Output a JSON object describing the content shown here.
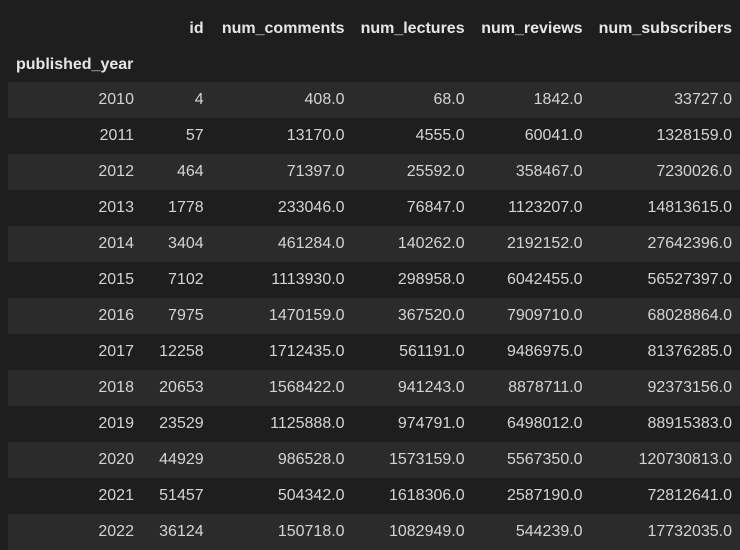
{
  "table": {
    "index_name": "published_year",
    "columns": [
      "id",
      "num_comments",
      "num_lectures",
      "num_reviews",
      "num_subscribers"
    ],
    "rows": [
      {
        "year": "2010",
        "cells": [
          "4",
          "408.0",
          "68.0",
          "1842.0",
          "33727.0"
        ]
      },
      {
        "year": "2011",
        "cells": [
          "57",
          "13170.0",
          "4555.0",
          "60041.0",
          "1328159.0"
        ]
      },
      {
        "year": "2012",
        "cells": [
          "464",
          "71397.0",
          "25592.0",
          "358467.0",
          "7230026.0"
        ]
      },
      {
        "year": "2013",
        "cells": [
          "1778",
          "233046.0",
          "76847.0",
          "1123207.0",
          "14813615.0"
        ]
      },
      {
        "year": "2014",
        "cells": [
          "3404",
          "461284.0",
          "140262.0",
          "2192152.0",
          "27642396.0"
        ]
      },
      {
        "year": "2015",
        "cells": [
          "7102",
          "1113930.0",
          "298958.0",
          "6042455.0",
          "56527397.0"
        ]
      },
      {
        "year": "2016",
        "cells": [
          "7975",
          "1470159.0",
          "367520.0",
          "7909710.0",
          "68028864.0"
        ]
      },
      {
        "year": "2017",
        "cells": [
          "12258",
          "1712435.0",
          "561191.0",
          "9486975.0",
          "81376285.0"
        ]
      },
      {
        "year": "2018",
        "cells": [
          "20653",
          "1568422.0",
          "941243.0",
          "8878711.0",
          "92373156.0"
        ]
      },
      {
        "year": "2019",
        "cells": [
          "23529",
          "1125888.0",
          "974791.0",
          "6498012.0",
          "88915383.0"
        ]
      },
      {
        "year": "2020",
        "cells": [
          "44929",
          "986528.0",
          "1573159.0",
          "5567350.0",
          "120730813.0"
        ]
      },
      {
        "year": "2021",
        "cells": [
          "51457",
          "504342.0",
          "1618306.0",
          "2587190.0",
          "72812641.0"
        ]
      },
      {
        "year": "2022",
        "cells": [
          "36124",
          "150718.0",
          "1082949.0",
          "544239.0",
          "17732035.0"
        ]
      }
    ]
  }
}
